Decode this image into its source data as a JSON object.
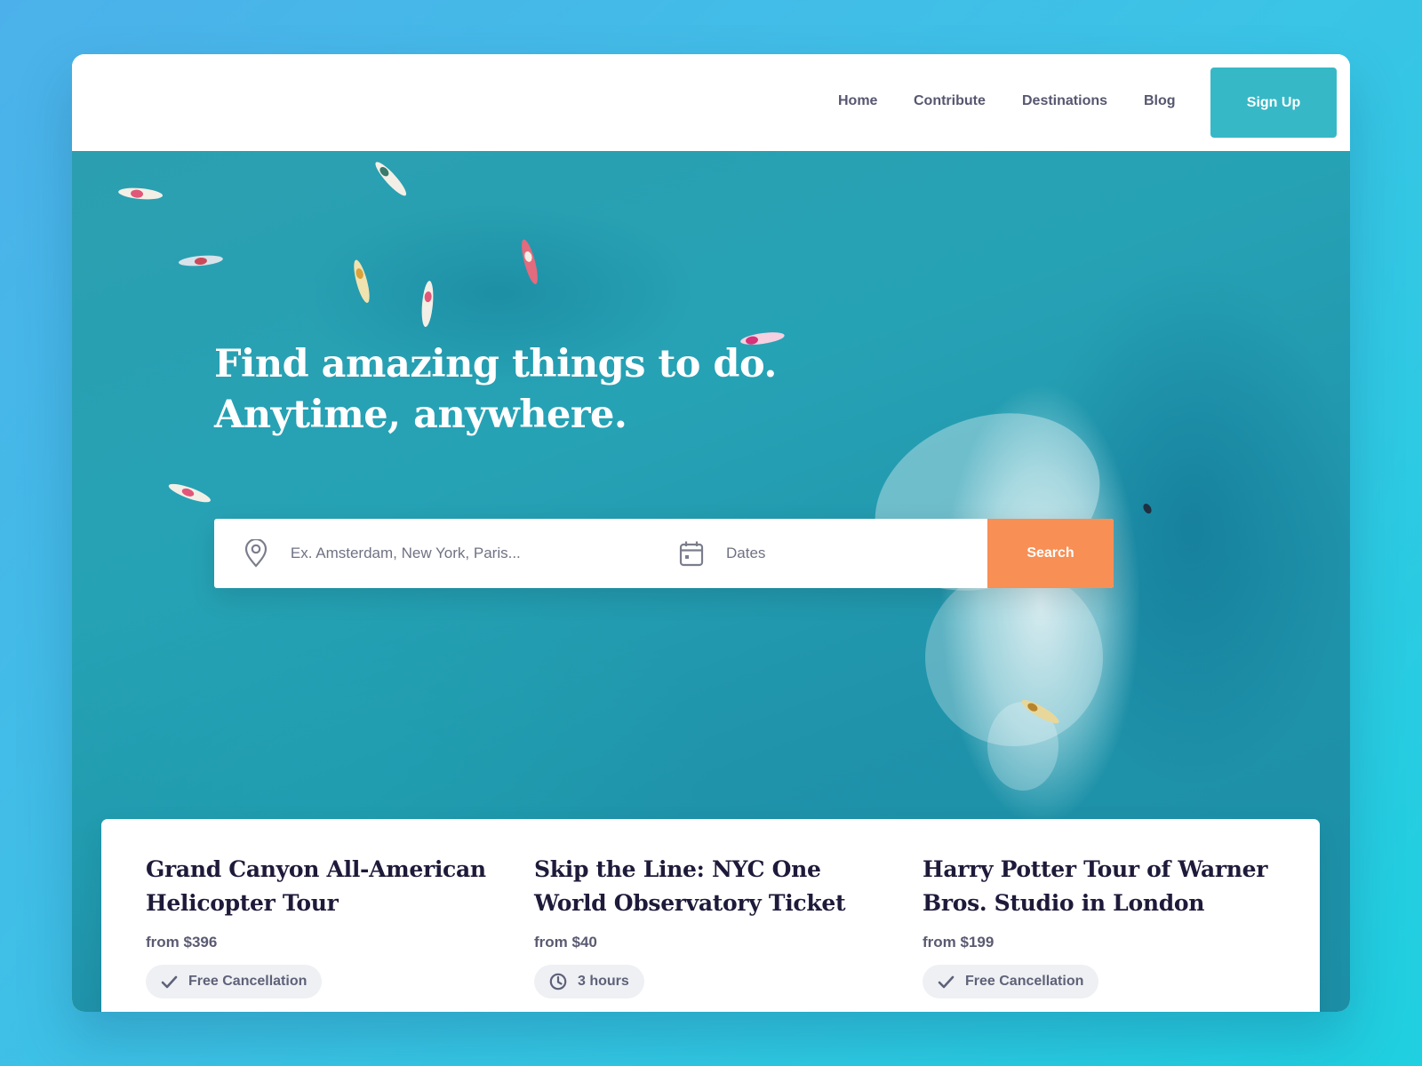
{
  "nav": {
    "links": [
      {
        "label": "Home"
      },
      {
        "label": "Contribute"
      },
      {
        "label": "Destinations"
      },
      {
        "label": "Blog"
      }
    ],
    "signup_label": "Sign Up"
  },
  "hero": {
    "headline_line1": "Find amazing things to do.",
    "headline_line2": "Anytime, anywhere."
  },
  "search": {
    "location_placeholder": "Ex. Amsterdam, New York, Paris...",
    "location_icon": "map-pin-icon",
    "dates_placeholder": "Dates",
    "dates_icon": "calendar-icon",
    "button_label": "Search",
    "button_color": "#f88f55"
  },
  "brand": {
    "accent_color": "#37b8c6",
    "title_color": "#1e1a3a"
  },
  "cards": [
    {
      "title": "Grand Canyon All-American Helicopter Tour",
      "price": "from $396",
      "badge_icon": "check-icon",
      "badge_label": "Free Cancellation"
    },
    {
      "title": "Skip the Line: NYC One World Observatory Ticket",
      "price": "from $40",
      "badge_icon": "clock-icon",
      "badge_label": "3 hours"
    },
    {
      "title": "Harry Potter Tour of Warner Bros. Studio in London",
      "price": "from $199",
      "badge_icon": "check-icon",
      "badge_label": "Free Cancellation"
    }
  ]
}
